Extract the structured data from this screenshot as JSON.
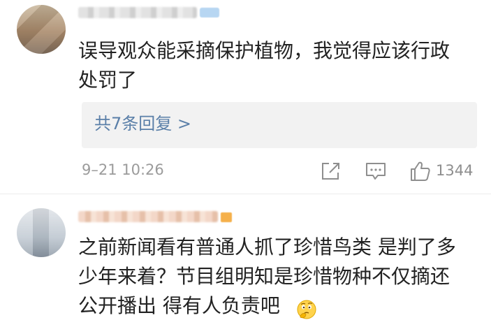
{
  "comments": [
    {
      "text_lines": [
        "误导观众能采摘保护植物，我觉得应该行政",
        "处罚了"
      ],
      "reply_link": "共7条回复 >",
      "timestamp": "9–21 10:26",
      "like_count": "1344"
    },
    {
      "text_lines": [
        "之前新闻看有普通人抓了珍惜鸟类 是判了多",
        "少年来着？节目组明知是珍惜物种不仅摘还",
        "公开播出 得有人负责吧"
      ],
      "emoji": "thinking-face-emoji"
    }
  ],
  "icons": {
    "share": "share-icon",
    "comment": "comment-icon",
    "like": "thumbs-up-icon"
  },
  "colors": {
    "link": "#5a7fa8",
    "muted": "#9b9b9b",
    "reply_bg": "#f2f2f2"
  }
}
